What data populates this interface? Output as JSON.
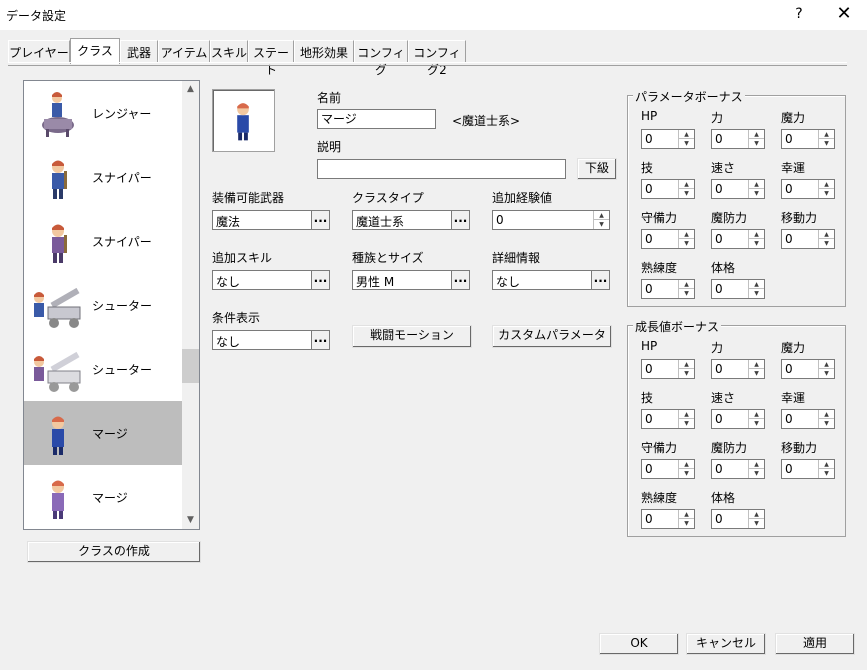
{
  "window": {
    "title": "データ設定",
    "help_label": "?",
    "close_label": "✕"
  },
  "tabs": [
    "プレイヤー",
    "クラス",
    "武器",
    "アイテム",
    "スキル",
    "ステート",
    "地形効果",
    "コンフィグ",
    "コンフィグ2"
  ],
  "class_list": {
    "items": [
      {
        "label": "レンジャー",
        "icon": "mounted-ranger-sprite",
        "selected": false
      },
      {
        "label": "スナイパー",
        "icon": "sniper-sprite",
        "selected": false
      },
      {
        "label": "スナイパー",
        "icon": "sniper-sprite",
        "selected": false
      },
      {
        "label": "シューター",
        "icon": "ballista-shooter-sprite",
        "selected": false
      },
      {
        "label": "シューター",
        "icon": "ballista-shooter-sprite",
        "selected": false
      },
      {
        "label": "マージ",
        "icon": "mage-sprite",
        "selected": true
      },
      {
        "label": "マージ",
        "icon": "mage-sprite",
        "selected": false
      }
    ],
    "create_button": "クラスの作成"
  },
  "detail": {
    "name_label": "名前",
    "name_value": "マージ",
    "type_hint": "<魔道士系>",
    "desc_label": "説明",
    "desc_value": "",
    "lower_button": "下級",
    "weapon_label": "装備可能武器",
    "weapon_value": "魔法",
    "class_type_label": "クラスタイプ",
    "class_type_value": "魔道士系",
    "exp_label": "追加経験値",
    "exp_value": "0",
    "skill_label": "追加スキル",
    "skill_value": "なし",
    "race_label": "種族とサイズ",
    "race_value": "男性 M",
    "info_label": "詳細情報",
    "info_value": "なし",
    "cond_label": "条件表示",
    "cond_value": "なし",
    "motion_button": "戦闘モーション",
    "custom_button": "カスタムパラメータ",
    "dots": "..."
  },
  "param_bonus": {
    "title": "パラメータボーナス",
    "fields": [
      {
        "label": "HP",
        "value": "0"
      },
      {
        "label": "力",
        "value": "0"
      },
      {
        "label": "魔力",
        "value": "0"
      },
      {
        "label": "技",
        "value": "0"
      },
      {
        "label": "速さ",
        "value": "0"
      },
      {
        "label": "幸運",
        "value": "0"
      },
      {
        "label": "守備力",
        "value": "0"
      },
      {
        "label": "魔防力",
        "value": "0"
      },
      {
        "label": "移動力",
        "value": "0"
      },
      {
        "label": "熟練度",
        "value": "0"
      },
      {
        "label": "体格",
        "value": "0"
      }
    ]
  },
  "growth_bonus": {
    "title": "成長値ボーナス",
    "fields": [
      {
        "label": "HP",
        "value": "0"
      },
      {
        "label": "力",
        "value": "0"
      },
      {
        "label": "魔力",
        "value": "0"
      },
      {
        "label": "技",
        "value": "0"
      },
      {
        "label": "速さ",
        "value": "0"
      },
      {
        "label": "幸運",
        "value": "0"
      },
      {
        "label": "守備力",
        "value": "0"
      },
      {
        "label": "魔防力",
        "value": "0"
      },
      {
        "label": "移動力",
        "value": "0"
      },
      {
        "label": "熟練度",
        "value": "0"
      },
      {
        "label": "体格",
        "value": "0"
      }
    ]
  },
  "footer": {
    "ok": "OK",
    "cancel": "キャンセル",
    "apply": "適用"
  }
}
